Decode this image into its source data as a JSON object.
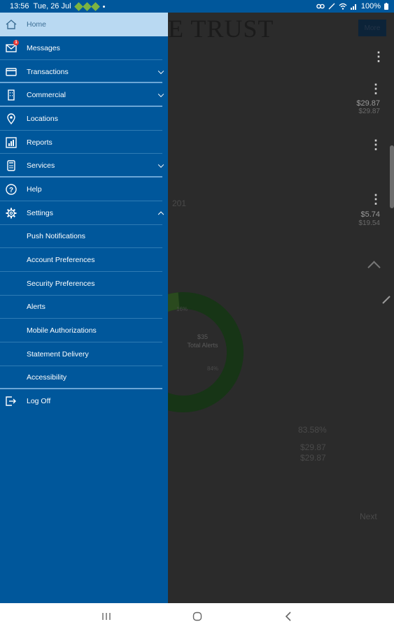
{
  "status_bar": {
    "time": "13:56",
    "date": "Tue, 26 Jul",
    "battery": "100%"
  },
  "background": {
    "title": "E TRUST",
    "more_label": "More",
    "amount_1": "$29.87",
    "amount_1_sub": "$29.87",
    "amount_2": "$5.74",
    "amount_2_sub": "$19.54",
    "faint_code": "201",
    "donut_center_value": "$35",
    "donut_center_label": "Total Alerts",
    "donut_pct_a": "16%",
    "donut_pct_b": "84%",
    "percent": "83.58%",
    "amount_3": "$29.87",
    "amount_4": "$29.87",
    "next_label": "Next"
  },
  "drawer": {
    "items": [
      {
        "label": "Home",
        "icon": "home-icon"
      },
      {
        "label": "Messages",
        "icon": "messages-icon",
        "badge": "1"
      },
      {
        "label": "Transactions",
        "icon": "transactions-icon"
      },
      {
        "label": "Commercial",
        "icon": "commercial-icon"
      },
      {
        "label": "Locations",
        "icon": "location-pin-icon"
      },
      {
        "label": "Reports",
        "icon": "reports-icon"
      },
      {
        "label": "Services",
        "icon": "services-icon"
      },
      {
        "label": "Help",
        "icon": "help-icon"
      },
      {
        "label": "Settings",
        "icon": "gear-icon"
      }
    ],
    "settings_sub": [
      "Push Notifications",
      "Account Preferences",
      "Security Preferences",
      "Alerts",
      "Mobile Authorizations",
      "Statement Delivery",
      "Accessibility"
    ],
    "logoff": "Log Off"
  }
}
